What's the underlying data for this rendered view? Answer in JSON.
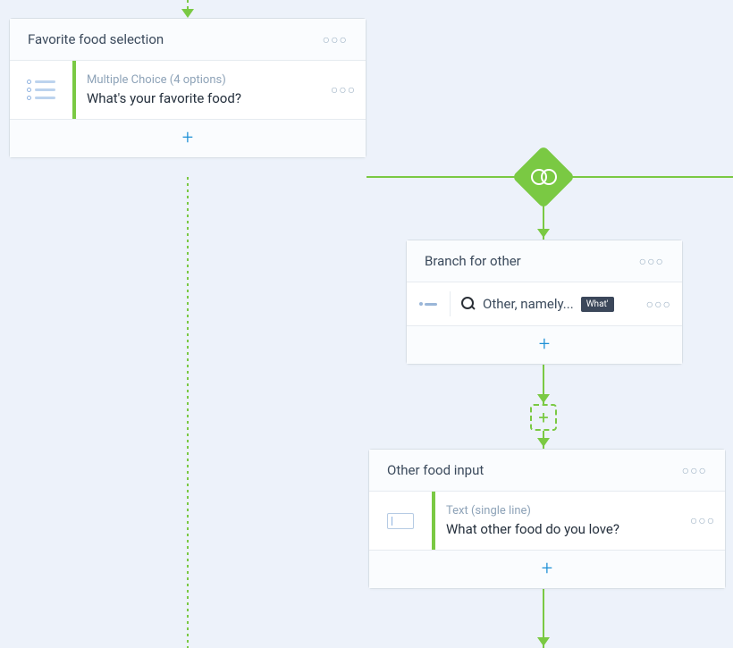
{
  "cards": {
    "favorite": {
      "title": "Favorite food selection",
      "question_type": "Multiple Choice (4 options)",
      "question_text": "What's your favorite food?"
    },
    "branch": {
      "title": "Branch for other",
      "option_label": "Other, namely...",
      "option_tag": "What'"
    },
    "other": {
      "title": "Other food input",
      "question_type": "Text (single line)",
      "question_text": "What other food do you love?"
    }
  },
  "glyphs": {
    "plus": "+",
    "dots": "○○○"
  }
}
